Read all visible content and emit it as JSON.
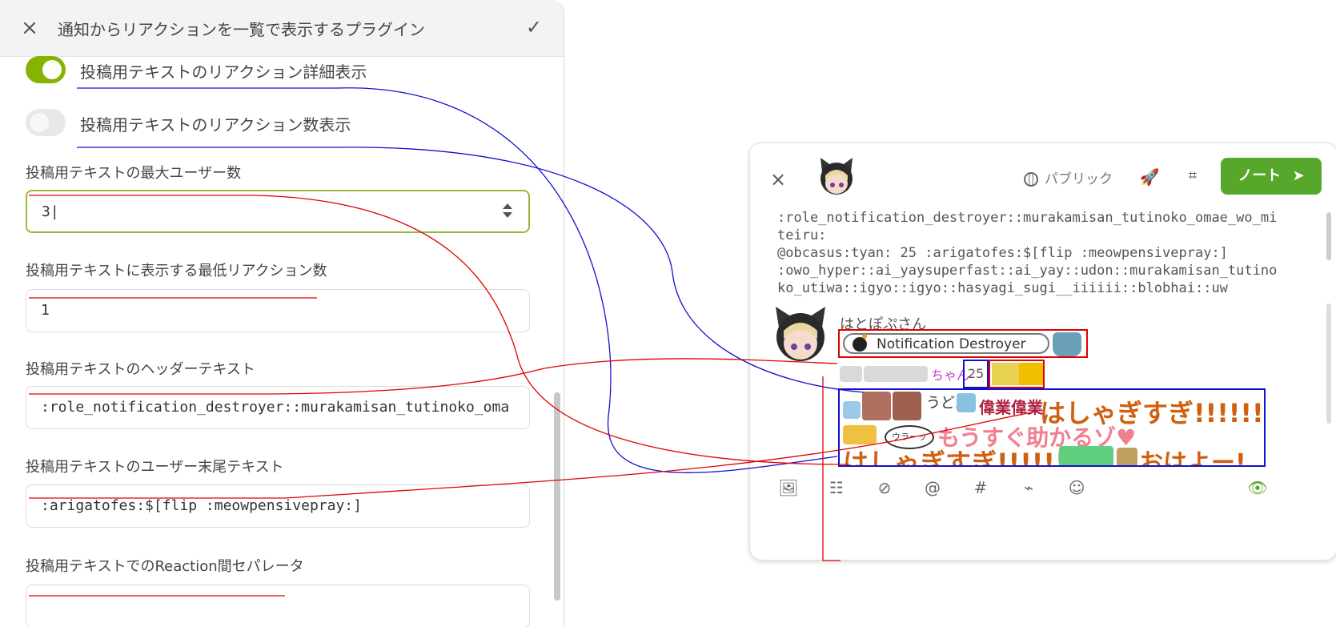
{
  "settings": {
    "header": {
      "title": "通知からリアクションを一覧で表示するプラグイン",
      "close_icon": "×",
      "check_icon": "✓"
    },
    "toggles": [
      {
        "label": "投稿用テキストのリアクション詳細表示",
        "on": true
      },
      {
        "label": "投稿用テキストのリアクション数表示",
        "on": false
      }
    ],
    "fields": [
      {
        "label": "投稿用テキストの最大ユーザー数",
        "value": "3"
      },
      {
        "label": "投稿用テキストに表示する最低リアクション数",
        "value": "1"
      },
      {
        "label": "投稿用テキストのヘッダーテキスト",
        "value": ":role_notification_destroyer::murakamisan_tutinoko_oma"
      },
      {
        "label": "投稿用テキストのユーザー末尾テキスト",
        "value": ":arigatofes:$[flip :meowpensivepray:]"
      },
      {
        "label": "投稿用テキストでのReaction間セパレータ",
        "value": ""
      }
    ]
  },
  "composer": {
    "close_icon": "×",
    "visibility_label": "パブリック",
    "note_button_label": "ノート",
    "note_button_icon": "➤",
    "rocket_icon": "🚀",
    "plugin_icon": "⌗",
    "text": ":role_notification_destroyer::murakamisan_tutinoko_omae_wo_miteiru:\n@obcasus:tyan: 25 :arigatofes:$[flip :meowpensivepray:]\n:owo_hyper::ai_yaysuperfast::ai_yay::udon::murakamisan_tutinoko_utiwa::igyo::igyo::hasyagi_sugi__iiiiii::blobhai::uw",
    "preview": {
      "author_name": "はとぽぷさん",
      "header_text": "Notification Destroyer",
      "user_suffix": "ちゃん",
      "count": "25",
      "reaction_udon": "うどん",
      "reaction_gyogyo": "偉業偉業",
      "reaction_line1": "はしゃぎすぎ!!!!!!",
      "reaction_line2": "もうすぐ助かるゾ♥",
      "reaction_line3": "はしゃぎすぎ!!!!!!",
      "reaction_line3b": "おはよー!",
      "reaction_bubble": "ウラーッ"
    },
    "toolbar_icons": [
      "image-plus-icon",
      "poll-icon",
      "eye-off-icon",
      "mention-icon",
      "hashtag-icon",
      "plugin-icon",
      "emoji-icon"
    ],
    "toolbar_glyphs": [
      "🖼",
      "☷",
      "⊘",
      "@",
      "#",
      "⌁",
      "☺"
    ],
    "eye_icon": "👁"
  },
  "colors": {
    "accent": "#86b300",
    "note_button": "#57a72b",
    "annotation_red": "#e00000",
    "annotation_blue": "#1010d0"
  }
}
